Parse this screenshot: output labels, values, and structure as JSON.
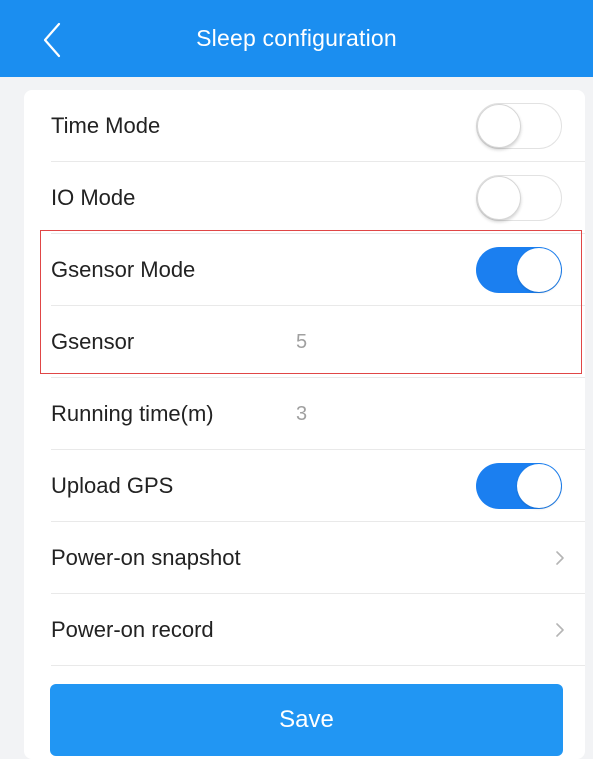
{
  "header": {
    "title": "Sleep configuration",
    "back_icon": "chevron-left-icon",
    "background_color": "#1b8ef0"
  },
  "settings": {
    "time_mode": {
      "label": "Time Mode",
      "enabled": false
    },
    "io_mode": {
      "label": "IO Mode",
      "enabled": false
    },
    "gsensor_mode": {
      "label": "Gsensor Mode",
      "enabled": true
    },
    "gsensor": {
      "label": "Gsensor",
      "value": "5"
    },
    "running_time": {
      "label": "Running time(m)",
      "value": "3"
    },
    "upload_gps": {
      "label": "Upload GPS",
      "enabled": true
    },
    "power_on_snapshot": {
      "label": "Power-on snapshot",
      "icon": "chevron-right-icon"
    },
    "power_on_record": {
      "label": "Power-on record",
      "icon": "chevron-right-icon"
    }
  },
  "actions": {
    "save_label": "Save"
  },
  "colors": {
    "accent": "#1b7ff0",
    "save_button": "#2196f3",
    "highlight_border": "#e04646"
  }
}
